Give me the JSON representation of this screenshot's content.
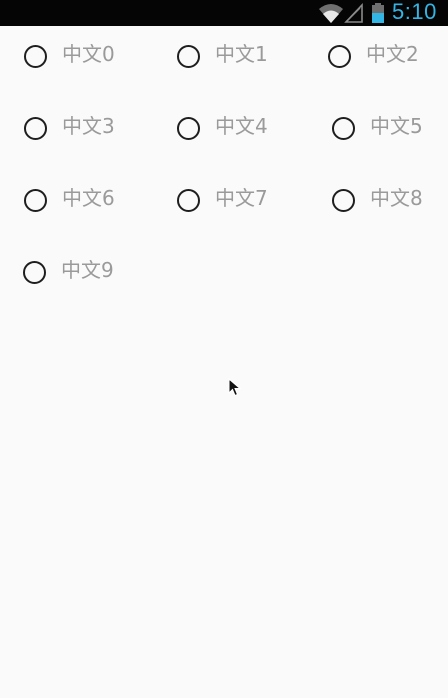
{
  "status_bar": {
    "time": "5:10",
    "icons": [
      "wifi-icon",
      "cell-signal-icon",
      "battery-icon"
    ],
    "accent_color": "#33b5e5"
  },
  "radio_group": {
    "options": [
      {
        "label": "中文0",
        "checked": false
      },
      {
        "label": "中文1",
        "checked": false
      },
      {
        "label": "中文2",
        "checked": false
      },
      {
        "label": "中文3",
        "checked": false
      },
      {
        "label": "中文4",
        "checked": false
      },
      {
        "label": "中文5",
        "checked": false
      },
      {
        "label": "中文6",
        "checked": false
      },
      {
        "label": "中文7",
        "checked": false
      },
      {
        "label": "中文8",
        "checked": false
      },
      {
        "label": "中文9",
        "checked": false
      }
    ],
    "label_color": "#9a9a9a",
    "circle_color": "#1e1e1e",
    "background": "#fafafa"
  }
}
